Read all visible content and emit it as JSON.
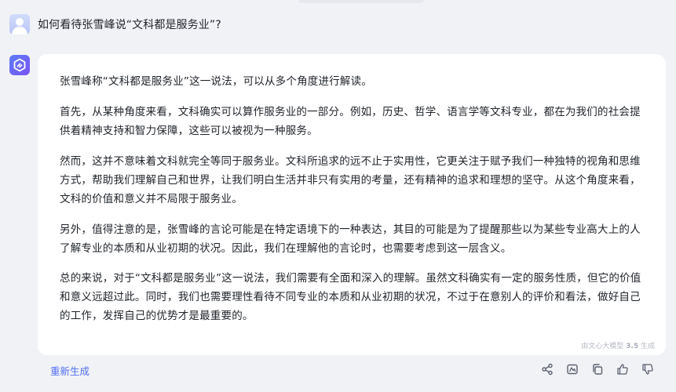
{
  "question": {
    "text": "如何看待张雪峰说“文科都是服务业”?"
  },
  "answer": {
    "paragraphs": [
      "张雪峰称“文科都是服务业”这一说法，可以从多个角度进行解读。",
      "首先，从某种角度来看，文科确实可以算作服务业的一部分。例如，历史、哲学、语言学等文科专业，都在为我们的社会提供着精神支持和智力保障，这些可以被视为一种服务。",
      "然而，这并不意味着文科就完全等同于服务业。文科所追求的远不止于实用性，它更关注于赋予我们一种独特的视角和思维方式，帮助我们理解自己和世界，让我们明白生活并非只有实用的考量，还有精神的追求和理想的坚守。从这个角度来看，文科的价值和意义并不局限于服务业。",
      "另外，值得注意的是，张雪峰的言论可能是在特定语境下的一种表达，其目的可能是为了提醒那些以为某些专业高大上的人了解专业的本质和从业初期的状况。因此，我们在理解他的言论时，也需要考虑到这一层含义。",
      "总的来说，对于“文科都是服务业”这一说法，我们需要有全面和深入的理解。虽然文科确实有一定的服务性质，但它的价值和意义远超过此。同时，我们也需要理性看待不同专业的本质和从业初期的状况，不过于在意别人的评价和看法，做好自己的工作，发挥自己的优势才是最重要的。"
    ],
    "model_tag_prefix": "由文心大模型",
    "model_tag_version": "3.5",
    "model_tag_suffix": "生成"
  },
  "footer": {
    "regenerate_label": "重新生成",
    "icons": [
      "share-icon",
      "image-icon",
      "copy-icon",
      "thumbs-up-icon",
      "thumbs-down-icon"
    ]
  },
  "colors": {
    "background": "#f1f2f6",
    "card": "#ffffff",
    "text": "#1f2329",
    "accent": "#4e6ef2",
    "icon": "#5c6070"
  }
}
